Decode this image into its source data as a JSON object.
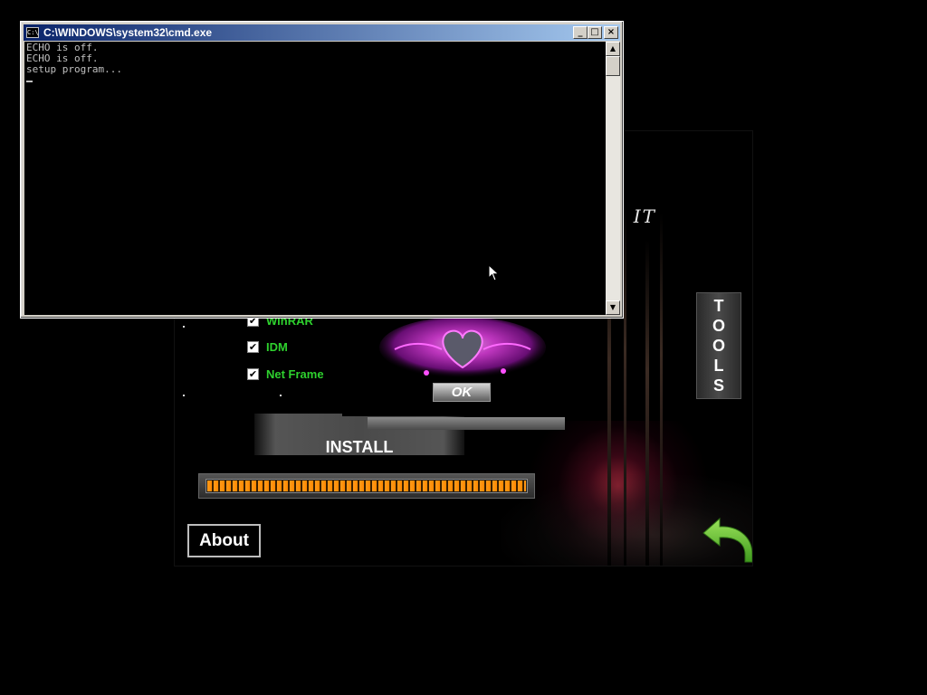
{
  "cmd": {
    "title": "C:\\WINDOWS\\system32\\cmd.exe",
    "icon_text": "C:\\",
    "console_lines": [
      "ECHO is off.",
      "ECHO is off.",
      "setup program..."
    ],
    "minimize": "_",
    "maximize": "□",
    "close": "×",
    "scroll_up": "▲",
    "scroll_down": "▼"
  },
  "installer": {
    "brand_text": ", IT",
    "tools_letters": [
      "T",
      "O",
      "O",
      "L",
      "S"
    ],
    "options": [
      {
        "label": "WinRAR",
        "checked": true
      },
      {
        "label": "IDM",
        "checked": true
      },
      {
        "label": "Net Frame",
        "checked": true
      }
    ],
    "install_label": "INSTALL",
    "progress_fraction": 1.0,
    "about_label": "About",
    "back_icon": "back-arrow-icon"
  },
  "dialog": {
    "ok_label": "OK"
  },
  "colors": {
    "option_green": "#2ed12e",
    "progress_orange": "#ff8800",
    "cmd_title_blue": "#0a246a",
    "heart_magenta": "#e040e0",
    "back_arrow_green": "#6cc23a"
  }
}
